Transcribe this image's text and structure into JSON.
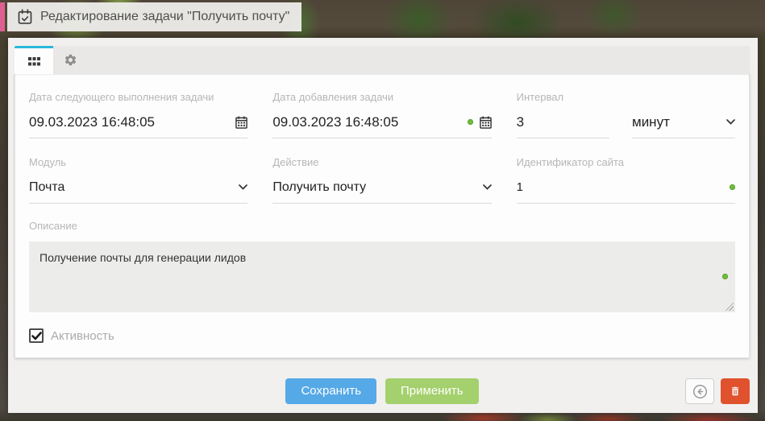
{
  "title_bar": {
    "title": "Редактирование задачи \"Получить почту\""
  },
  "tabs": {
    "main_icon": "grid-icon",
    "settings_icon": "gear-icon"
  },
  "fields": {
    "next_run_date": {
      "label": "Дата следующего выполнения задачи",
      "value": "09.03.2023 16:48:05"
    },
    "created_date": {
      "label": "Дата добавления задачи",
      "value": "09.03.2023 16:48:05"
    },
    "interval": {
      "label": "Интервал",
      "value": "3",
      "unit_selected": "минут"
    },
    "module": {
      "label": "Модуль",
      "value": "Почта"
    },
    "action": {
      "label": "Действие",
      "value": "Получить почту"
    },
    "site_id": {
      "label": "Идентификатор сайта",
      "value": "1"
    },
    "description": {
      "label": "Описание",
      "value": "Получение почты для генерации лидов"
    },
    "active": {
      "label": "Активность",
      "checked_attr": "checked"
    }
  },
  "buttons": {
    "save": "Сохранить",
    "apply": "Применить"
  },
  "icons": {
    "title": "calendar-check-icon",
    "date_picker": "calendar-icon",
    "dropdown": "chevron-down-icon",
    "back": "arrow-left-circle-icon",
    "delete": "trash-icon",
    "indicator": "green-dot-icon"
  },
  "colors": {
    "accent_pink": "#df6090",
    "tab_active_cyan": "#29b7d9",
    "save_blue": "#55a9e7",
    "apply_green": "#a4d06d",
    "delete_red": "#e0522d",
    "indicator_green": "#72bd3e"
  }
}
